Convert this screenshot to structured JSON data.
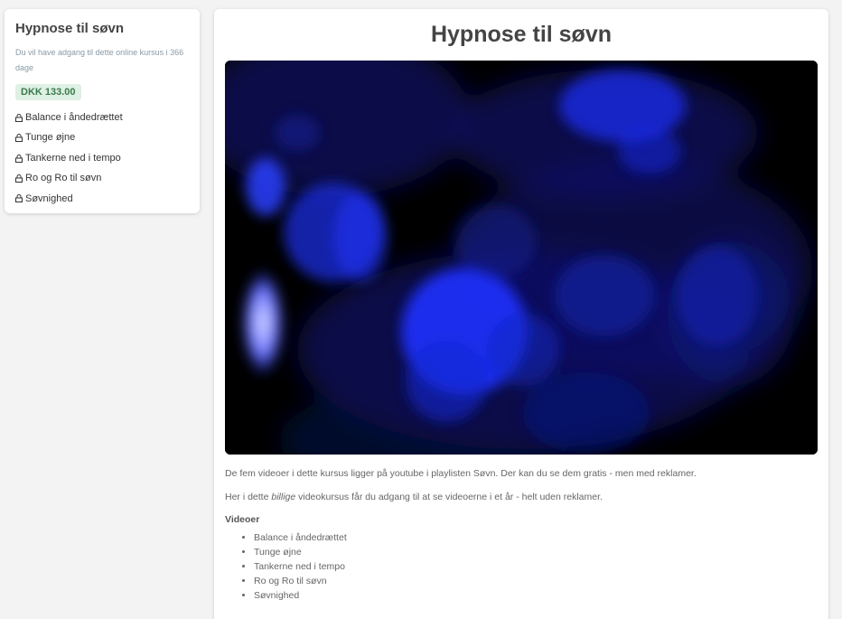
{
  "sidebar": {
    "title": "Hypnose til søvn",
    "access_text": "Du vil have adgang til dette online kursus i 366 dage",
    "price": "DKK 133.00",
    "items": [
      {
        "label": "Balance i åndedrættet"
      },
      {
        "label": "Tunge øjne"
      },
      {
        "label": "Tankerne ned i tempo"
      },
      {
        "label": "Ro og Ro til søvn"
      },
      {
        "label": "Søvnighed"
      }
    ]
  },
  "main": {
    "title": "Hypnose til søvn",
    "para1": "De fem videoer i dette kursus ligger på youtube i playlisten Søvn. Der kan du se dem gratis - men med reklamer.",
    "para2_before": "Her i dette ",
    "para2_em": "billige",
    "para2_after": " videokursus får du adgang til at se videoerne i et år - helt uden reklamer.",
    "videos_heading": "Videoer",
    "videos": [
      {
        "label": "Balance i åndedrættet"
      },
      {
        "label": "Tunge øjne"
      },
      {
        "label": "Tankerne ned i tempo"
      },
      {
        "label": "Ro og Ro til søvn"
      },
      {
        "label": "Søvnighed"
      }
    ]
  },
  "colors": {
    "price_bg": "#dff0e4",
    "price_text": "#3a7a4c",
    "hero_blue": "#1a2cff"
  }
}
